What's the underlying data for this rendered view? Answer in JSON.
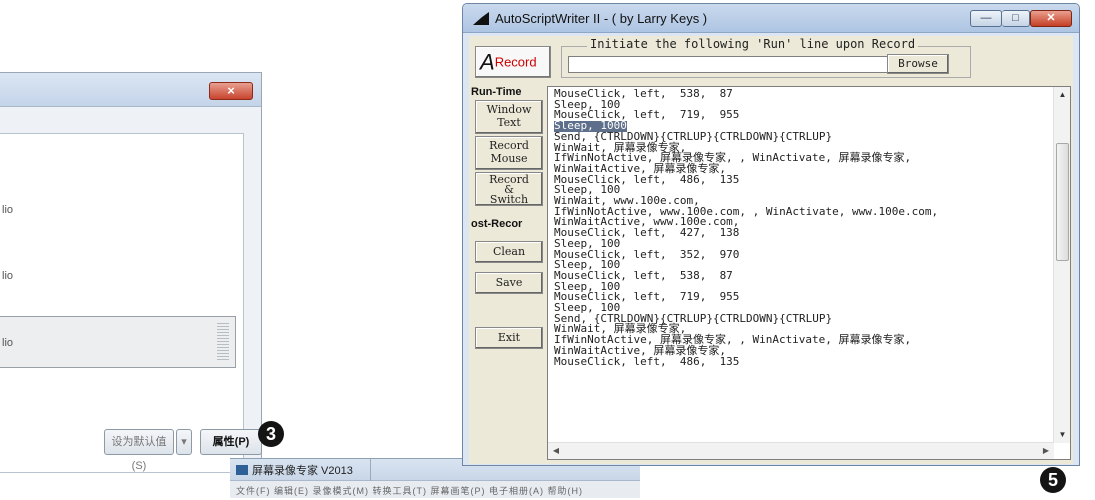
{
  "left_dialog": {
    "close_glyph": "×",
    "devices": [
      "lio",
      "lio",
      "lio"
    ],
    "set_default_label": "设为默认值(S)",
    "dropdown_glyph": "▾",
    "properties_label": "属性(P)",
    "badge": "3"
  },
  "sub_window": {
    "title": "屏幕录像专家 V2013",
    "menu": "文件(F)  编辑(E)  录像模式(M)  转换工具(T)  屏幕画笔(P)  电子相册(A)  帮助(H)"
  },
  "main_window": {
    "title": "AutoScriptWriter II - ( by Larry Keys )",
    "controls": {
      "minimize": "—",
      "maximize": "□",
      "close": "✕"
    },
    "record_button": {
      "prefix": "A",
      "label": "Record"
    },
    "initiate_label": "Initiate the following 'Run' line upon Record",
    "run_input_value": "",
    "browse_label": "Browse",
    "run_time_heading": "Run-Time",
    "window_text_button": "Window\nText",
    "record_mouse_button": "Record\nMouse",
    "record_switch_button": "Record\n&\nSwitch",
    "post_record_heading": "ost-Recor",
    "clean_label": "Clean",
    "save_label": "Save",
    "exit_label": "Exit",
    "scroll_up_glyph": "▲",
    "scroll_down_glyph": "▼",
    "scroll_left_glyph": "◀",
    "scroll_right_glyph": "▶",
    "script_lines": [
      "MouseClick, left,  538,  87",
      "Sleep, 100",
      "MouseClick, left,  719,  955",
      "Sleep, 1000",
      "Send, {CTRLDOWN}{CTRLUP}{CTRLDOWN}{CTRLUP}",
      "WinWait, 屏幕录像专家,",
      "IfWinNotActive, 屏幕录像专家, , WinActivate, 屏幕录像专家,",
      "WinWaitActive, 屏幕录像专家,",
      "MouseClick, left,  486,  135",
      "Sleep, 100",
      "WinWait, www.100e.com,",
      "IfWinNotActive, www.100e.com, , WinActivate, www.100e.com,",
      "WinWaitActive, www.100e.com,",
      "MouseClick, left,  427,  138",
      "Sleep, 100",
      "MouseClick, left,  352,  970",
      "Sleep, 100",
      "MouseClick, left,  538,  87",
      "Sleep, 100",
      "MouseClick, left,  719,  955",
      "Sleep, 100",
      "Send, {CTRLDOWN}{CTRLUP}{CTRLDOWN}{CTRLUP}",
      "WinWait, 屏幕录像专家,",
      "IfWinNotActive, 屏幕录像专家, , WinActivate, 屏幕录像专家,",
      "WinWaitActive, 屏幕录像专家,",
      "MouseClick, left,  486,  135"
    ],
    "selected_line_index": 3,
    "badge": "5"
  }
}
